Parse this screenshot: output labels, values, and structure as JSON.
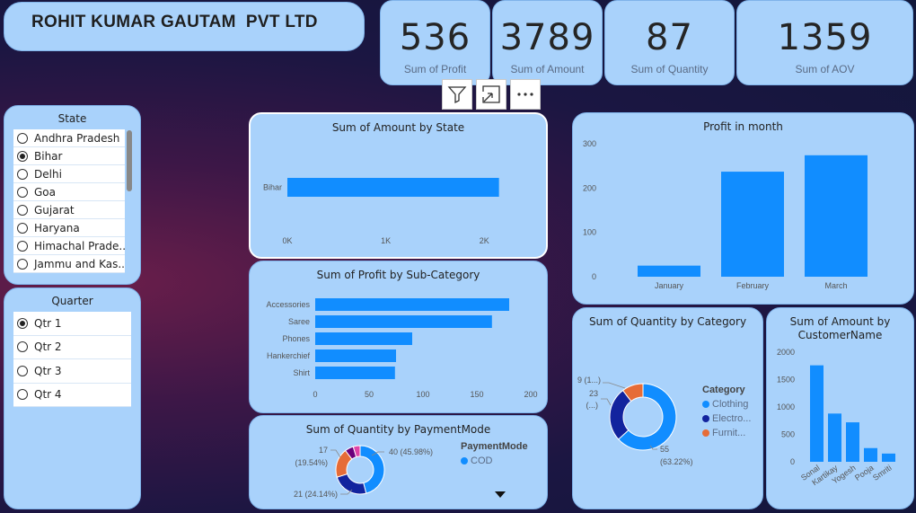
{
  "header": {
    "company": "ROHIT KUMAR GAUTAM  PVT LTD"
  },
  "kpis": [
    {
      "value": "536",
      "label": "Sum of Profit"
    },
    {
      "value": "3789",
      "label": "Sum of Amount"
    },
    {
      "value": "87",
      "label": "Sum of Quantity"
    },
    {
      "value": "1359",
      "label": "Sum of AOV"
    }
  ],
  "state_slicer": {
    "title": "State",
    "items": [
      "Andhra Pradesh",
      "Bihar",
      "Delhi",
      "Goa",
      "Gujarat",
      "Haryana",
      "Himachal Prade...",
      "Jammu and Kas..."
    ],
    "selected": "Bihar"
  },
  "quarter_slicer": {
    "title": "Quarter",
    "items": [
      "Qtr 1",
      "Qtr 2",
      "Qtr 3",
      "Qtr 4"
    ],
    "selected": "Qtr 1"
  },
  "toolbar": {
    "icons": [
      "filter-icon",
      "focus-mode-icon",
      "more-options-icon"
    ]
  },
  "colors": {
    "bar": "#118dff",
    "dark_blue": "#12239e",
    "orange": "#e66c37",
    "purple": "#6b007b",
    "pink": "#e044a7",
    "card": "#a9d2fb"
  },
  "chart_data": [
    {
      "id": "amount_by_state",
      "type": "bar",
      "orientation": "horizontal",
      "title": "Sum of Amount by State",
      "categories": [
        "Bihar"
      ],
      "values": [
        2150
      ],
      "xlim": [
        0,
        2500
      ],
      "ticks": [
        {
          "v": 0,
          "label": "0K"
        },
        {
          "v": 1000,
          "label": "1K"
        },
        {
          "v": 2000,
          "label": "2K"
        }
      ]
    },
    {
      "id": "profit_by_subcategory",
      "type": "bar",
      "orientation": "horizontal",
      "title": "Sum of Profit by Sub-Category",
      "categories": [
        "Accessories",
        "Saree",
        "Phones",
        "Hankerchief",
        "Shirt"
      ],
      "values": [
        180,
        164,
        90,
        75,
        74
      ],
      "xlim": [
        0,
        200
      ],
      "ticks": [
        {
          "v": 0,
          "label": "0"
        },
        {
          "v": 50,
          "label": "50"
        },
        {
          "v": 100,
          "label": "100"
        },
        {
          "v": 150,
          "label": "150"
        },
        {
          "v": 200,
          "label": "200"
        }
      ]
    },
    {
      "id": "quantity_by_paymentmode",
      "type": "pie",
      "donut": true,
      "title": "Sum of Quantity by PaymentMode",
      "legend_title": "PaymentMode",
      "legend": [
        {
          "name": "COD",
          "color": "#118dff"
        }
      ],
      "slices": [
        {
          "name": "COD",
          "value": 40,
          "color": "#118dff"
        },
        {
          "name": "",
          "value": 21,
          "color": "#12239e"
        },
        {
          "name": "",
          "value": 17,
          "color": "#e66c37"
        },
        {
          "name": "",
          "value": 5,
          "color": "#6b007b"
        },
        {
          "name": "",
          "value": 4,
          "color": "#e044a7"
        }
      ],
      "data_labels": [
        "40 (45.98%)",
        "21 (24.14%)",
        "17",
        "(19.54%)"
      ]
    },
    {
      "id": "profit_in_month",
      "type": "bar",
      "title": "Profit in month",
      "categories": [
        "January",
        "February",
        "March"
      ],
      "values": [
        25,
        237,
        274
      ],
      "ylim": [
        0,
        300
      ],
      "ticks": [
        {
          "v": 0,
          "label": "0"
        },
        {
          "v": 100,
          "label": "100"
        },
        {
          "v": 200,
          "label": "200"
        },
        {
          "v": 300,
          "label": "300"
        }
      ]
    },
    {
      "id": "quantity_by_category",
      "type": "pie",
      "donut": true,
      "title": "Sum of Quantity by Category",
      "legend_title": "Category",
      "legend": [
        {
          "name": "Clothing",
          "color": "#118dff"
        },
        {
          "name": "Electro...",
          "color": "#12239e"
        },
        {
          "name": "Furnit...",
          "color": "#e66c37"
        }
      ],
      "slices": [
        {
          "name": "Clothing",
          "value": 55,
          "color": "#118dff"
        },
        {
          "name": "Electro...",
          "value": 23,
          "color": "#12239e"
        },
        {
          "name": "Furnit...",
          "value": 9,
          "color": "#e66c37"
        }
      ],
      "data_labels": [
        "55",
        "(63.22%)",
        "23",
        "(...)",
        "9 (1...)"
      ]
    },
    {
      "id": "amount_by_customer",
      "type": "bar",
      "title": "Sum of Amount by CustomerName",
      "categories": [
        "Sonal",
        "Kartikay",
        "Yogesh",
        "Pooja",
        "Smriti"
      ],
      "values": [
        1760,
        880,
        720,
        250,
        150
      ],
      "ylim": [
        0,
        2000
      ],
      "ticks": [
        {
          "v": 0,
          "label": "0"
        },
        {
          "v": 500,
          "label": "500"
        },
        {
          "v": 1000,
          "label": "1000"
        },
        {
          "v": 1500,
          "label": "1500"
        },
        {
          "v": 2000,
          "label": "2000"
        }
      ]
    }
  ]
}
